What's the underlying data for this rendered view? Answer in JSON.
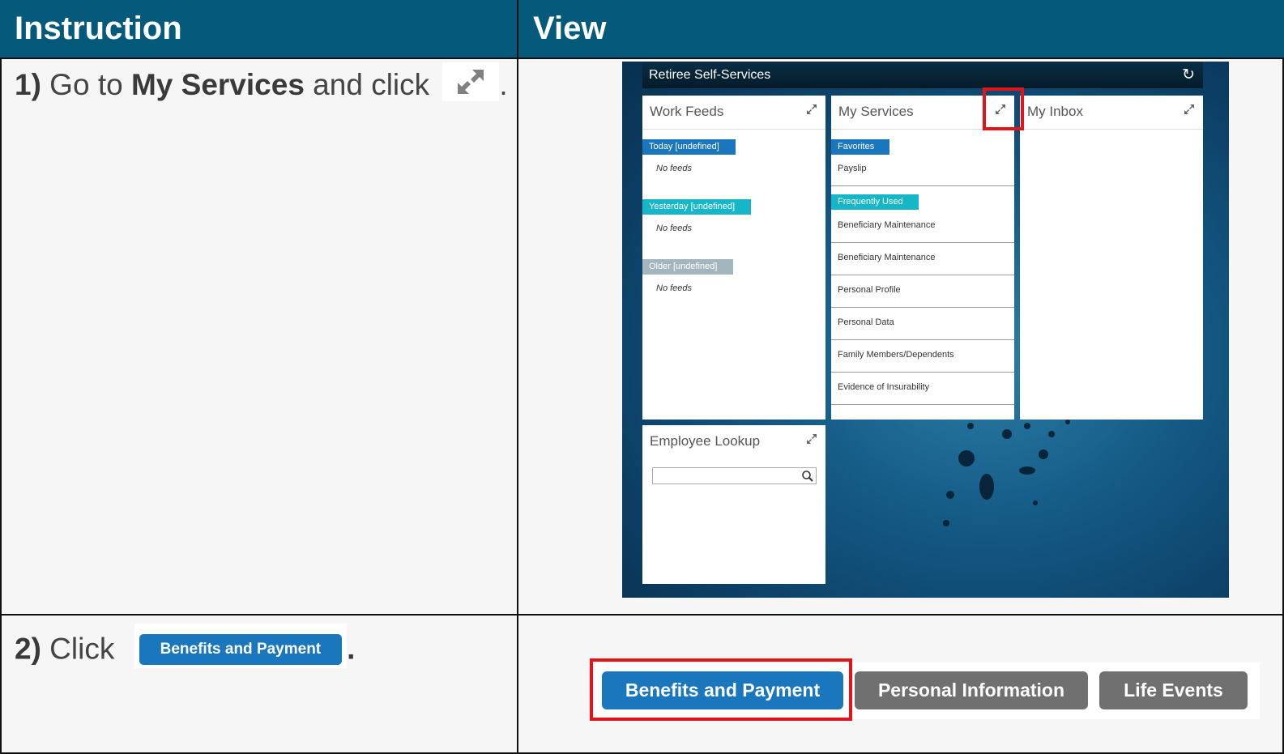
{
  "headers": {
    "instruction": "Instruction",
    "view": "View"
  },
  "step1": {
    "num": "1)",
    "pre": " Go to ",
    "bold": "My Services",
    "post": " and click ",
    "end": "."
  },
  "step2": {
    "num": "2)",
    "pre": " Click ",
    "button": "Benefits and Payment",
    "end": "."
  },
  "screenshot": {
    "title": "Retiree Self-Services",
    "work_feeds": {
      "title": "Work Feeds",
      "groups": [
        {
          "label": "Today [undefined]",
          "empty": "No feeds",
          "color": "#1a76bd"
        },
        {
          "label": "Yesterday [undefined]",
          "empty": "No feeds",
          "color": "#17b5c8"
        },
        {
          "label": "Older [undefined]",
          "empty": "No feeds",
          "color": "#a3b5bd"
        }
      ]
    },
    "my_services": {
      "title": "My Services",
      "favorites_label": "Favorites",
      "favorites": [
        "Payslip"
      ],
      "frequent_label": "Frequently Used",
      "frequent": [
        "Beneficiary Maintenance",
        "Beneficiary Maintenance",
        "Personal Profile",
        "Personal Data",
        "Family Members/Dependents",
        "Evidence of Insurability"
      ]
    },
    "my_inbox": {
      "title": "My Inbox"
    },
    "employee_lookup": {
      "title": "Employee Lookup",
      "search_value": ""
    }
  },
  "tabs": [
    "Benefits and Payment",
    "Personal Information",
    "Life Events"
  ],
  "colors": {
    "header": "#05597a",
    "primary_button": "#1a76bd",
    "secondary_button": "#707070",
    "highlight": "#e0141b"
  }
}
